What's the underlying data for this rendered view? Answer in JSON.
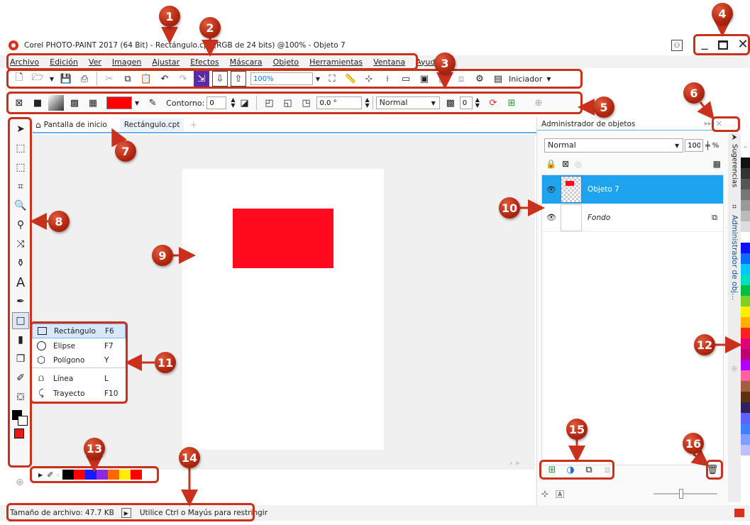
{
  "window": {
    "title": "Corel PHOTO-PAINT 2017 (64 Bit) - Rectángulo.cpt (RGB de 24 bits) @100% - Objeto 7"
  },
  "menu": [
    {
      "label": "Archivo"
    },
    {
      "label": "Edición"
    },
    {
      "label": "Ver"
    },
    {
      "label": "Imagen"
    },
    {
      "label": "Ajustar"
    },
    {
      "label": "Efectos"
    },
    {
      "label": "Máscara"
    },
    {
      "label": "Objeto"
    },
    {
      "label": "Herramientas"
    },
    {
      "label": "Ventana"
    },
    {
      "label": "Ayuda"
    }
  ],
  "toolbar": {
    "zoom_value": "100%",
    "launcher_label": "Iniciador"
  },
  "propbar": {
    "outline_label": "Contorno:",
    "outline_value": "0",
    "angle_value": "0.0 °",
    "blend_mode": "Normal",
    "transparency_value": "0",
    "fill_color": "#ff0000"
  },
  "tabs": {
    "home_label": "Pantalla de inicio",
    "doc_label": "Rectángulo.cpt"
  },
  "canvas": {
    "rect_color": "#ff0a1e"
  },
  "flyout": {
    "items": [
      {
        "name": "Rectángulo",
        "key": "F6",
        "icon": "rectangle-icon"
      },
      {
        "name": "Elipse",
        "key": "F7",
        "icon": "ellipse-icon"
      },
      {
        "name": "Polígono",
        "key": "Y",
        "icon": "polygon-icon"
      },
      {
        "name": "Línea",
        "key": "L",
        "icon": "line-icon"
      },
      {
        "name": "Trayecto",
        "key": "F10",
        "icon": "path-icon"
      }
    ]
  },
  "object_manager": {
    "title": "Administrador de objetos",
    "blend_mode": "Normal",
    "opacity_value": "100",
    "opacity_unit": "%",
    "objects": [
      {
        "name": "Objeto 7",
        "selected": true
      },
      {
        "name": "Fondo",
        "selected": false
      }
    ]
  },
  "side_tabs": {
    "hints": "Sugerencias",
    "object_manager": "Administrador de obj..."
  },
  "status": {
    "file_size": "Tamaño de archivo: 47.7 KB",
    "hint": "Utilice Ctrl o Mayús para restringir"
  },
  "document_palette": [
    "#000000",
    "#ff0000",
    "#1a1aff",
    "#8a2be2",
    "#ff6600",
    "#ffee00",
    "#ff0000"
  ],
  "color_palette": [
    "#111111",
    "#333333",
    "#555555",
    "#777777",
    "#999999",
    "#bbbbbb",
    "#dddddd",
    "#ffffff",
    "#1010ff",
    "#0a6cff",
    "#00c8ff",
    "#00e0c0",
    "#00c040",
    "#7fd020",
    "#ffee00",
    "#ffb000",
    "#ff2020",
    "#e0007a",
    "#c00070",
    "#b000ff",
    "#ff60a0",
    "#a06040",
    "#603010",
    "#302060",
    "#6060ff",
    "#4080ff",
    "#80a0ff",
    "#c0c0ff"
  ],
  "callouts": [
    "1",
    "2",
    "3",
    "4",
    "5",
    "6",
    "7",
    "8",
    "9",
    "10",
    "11",
    "12",
    "13",
    "14",
    "15",
    "16"
  ]
}
